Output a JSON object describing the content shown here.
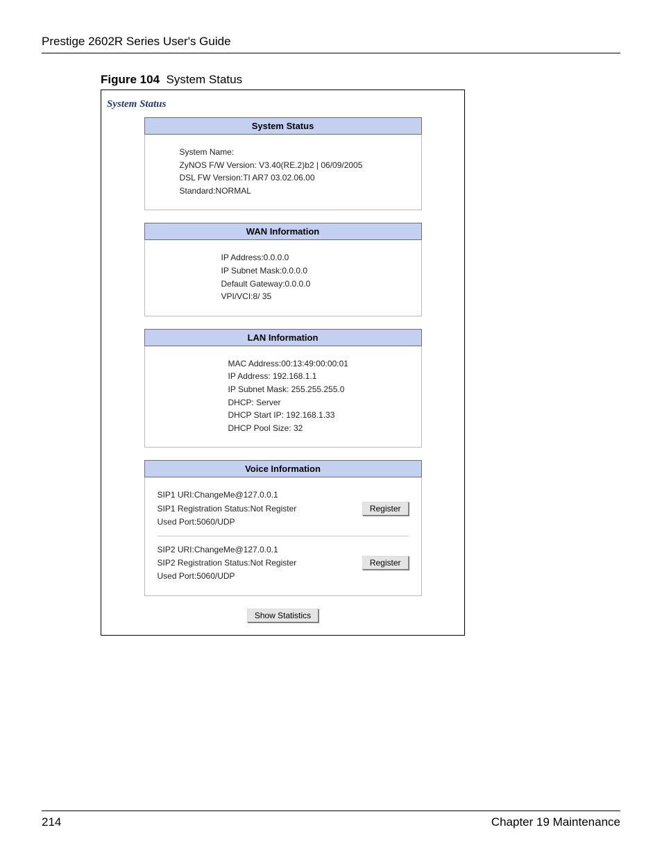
{
  "doc": {
    "header": "Prestige 2602R Series User's Guide",
    "figure_label": "Figure 104",
    "figure_title": "System Status",
    "page_number": "214",
    "chapter": "Chapter 19 Maintenance"
  },
  "screen": {
    "title": "System Status",
    "panels": {
      "system_status": {
        "header": "System Status",
        "lines": [
          "System Name:",
          "ZyNOS F/W Version: V3.40(RE.2)b2 | 06/09/2005",
          "DSL FW Version:TI AR7 03.02.06.00",
          "Standard:NORMAL"
        ]
      },
      "wan": {
        "header": "WAN Information",
        "lines": [
          "IP Address:0.0.0.0",
          "IP Subnet Mask:0.0.0.0",
          "Default Gateway:0.0.0.0",
          "VPI/VCI:8/ 35"
        ]
      },
      "lan": {
        "header": "LAN Information",
        "lines": [
          "MAC Address:00:13:49:00:00:01",
          "IP Address: 192.168.1.1",
          "IP Subnet Mask: 255.255.255.0",
          "DHCP: Server",
          "DHCP Start IP: 192.168.1.33",
          "DHCP Pool Size: 32"
        ]
      },
      "voice": {
        "header": "Voice Information",
        "sip1": {
          "uri": "SIP1 URI:ChangeMe@127.0.0.1",
          "status": "SIP1 Registration Status:Not Register",
          "port": "Used Port:5060/UDP",
          "button": "Register"
        },
        "sip2": {
          "uri": "SIP2 URI:ChangeMe@127.0.0.1",
          "status": "SIP2 Registration Status:Not Register",
          "port": "Used Port:5060/UDP",
          "button": "Register"
        }
      }
    },
    "show_stats_button": "Show Statistics"
  }
}
